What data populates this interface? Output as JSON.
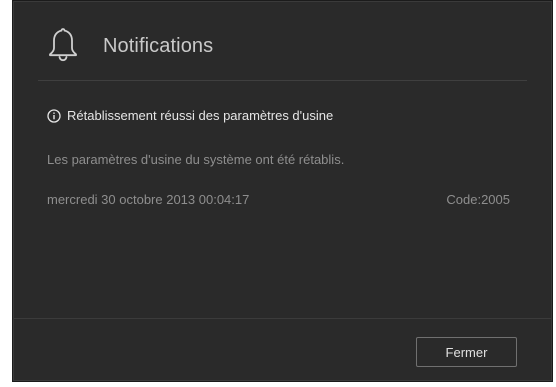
{
  "header": {
    "title": "Notifications",
    "icon": "bell-icon"
  },
  "notification": {
    "info_icon": "info-circle-icon",
    "heading": "Rétablissement réussi des paramètres d'usine",
    "message": "Les paramètres d'usine du système ont été rétablis.",
    "date": "mercredi 30 octobre 2013 00:04:17",
    "code": "Code:2005"
  },
  "footer": {
    "close_label": "Fermer"
  },
  "colors": {
    "dialog_background": "#2a2a2a",
    "primary_text": "#e6e6e6",
    "secondary_text": "#8e8e8e",
    "button_border": "#707070"
  }
}
